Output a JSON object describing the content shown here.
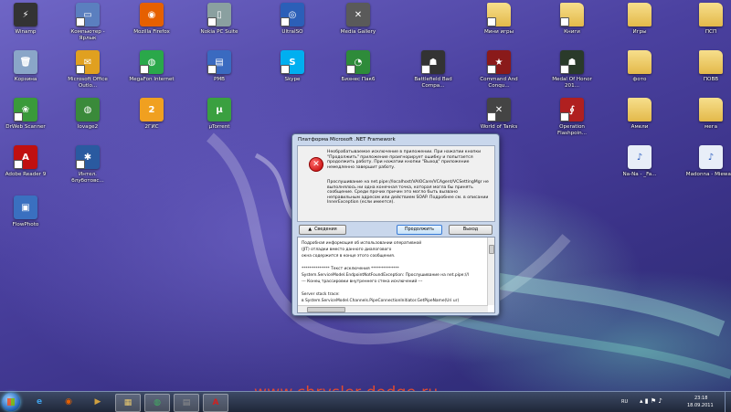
{
  "desktop": {
    "icons": [
      {
        "label": "Winamp",
        "color": "#333333",
        "glyph": "⚡",
        "link": false
      },
      {
        "label": "Компьютер - Ярлык",
        "color": "#5b7fbf",
        "glyph": "▭",
        "link": true
      },
      {
        "label": "Mozilla Firefox",
        "color": "#e66000",
        "glyph": "◉",
        "link": false
      },
      {
        "label": "Nokia PC Suite",
        "color": "#8aa0a0",
        "glyph": "▯",
        "link": true
      },
      {
        "label": "UltraISO",
        "color": "#2b5fb8",
        "glyph": "◎",
        "link": true
      },
      {
        "label": "Media Gallery",
        "color": "#5a5a5a",
        "glyph": "✕",
        "link": false
      },
      {
        "label": "Мини игры",
        "folder": true,
        "link": true
      },
      {
        "label": "Книги",
        "folder": true,
        "link": true
      },
      {
        "label": "Игры",
        "folder": true,
        "link": false
      },
      {
        "label": "ПСП",
        "folder": true,
        "link": false
      },
      {
        "label": "Корзина",
        "color": "#8aa6c8",
        "glyph": "🗑",
        "link": false
      },
      {
        "label": "Microsoft Office Outlo...",
        "color": "#e0a020",
        "glyph": "✉",
        "link": true
      },
      {
        "label": "MegaFon Internet",
        "color": "#2aa84a",
        "glyph": "◍",
        "link": true
      },
      {
        "label": "PMB",
        "color": "#3a6ac0",
        "glyph": "▤",
        "link": true
      },
      {
        "label": "Skype",
        "color": "#00aff0",
        "glyph": "S",
        "link": true
      },
      {
        "label": "Бизнес Пак6",
        "color": "#2e8b3a",
        "glyph": "◔",
        "link": true
      },
      {
        "label": "Battlefield Bad Compa...",
        "color": "#333333",
        "glyph": "☗",
        "link": true
      },
      {
        "label": "Command And Conqu...",
        "color": "#8a1a1a",
        "glyph": "★",
        "link": true
      },
      {
        "label": "Medal Of Honor 201...",
        "color": "#2a3a2a",
        "glyph": "☗",
        "link": true
      },
      {
        "label": "фото",
        "folder": true,
        "link": false
      },
      {
        "label": "ПОВВ",
        "folder": true,
        "link": false
      },
      {
        "label": "DrWeb Scanner",
        "color": "#3a9a3a",
        "glyph": "❀",
        "link": true
      },
      {
        "label": "lovage2",
        "color": "#3a8a3a",
        "glyph": "◍",
        "link": false
      },
      {
        "label": "2ГИС",
        "color": "#f0a020",
        "glyph": "2",
        "link": false
      },
      {
        "label": "µTorrent",
        "color": "#3aa040",
        "glyph": "µ",
        "link": false
      },
      {
        "label": "World of Tanks",
        "color": "#444444",
        "glyph": "✕",
        "link": true
      },
      {
        "label": "Operation Flashpoin...",
        "color": "#b02020",
        "glyph": "∮",
        "link": true
      },
      {
        "label": "Амели",
        "folder": true,
        "link": false
      },
      {
        "label": "мега",
        "folder": true,
        "link": false
      },
      {
        "label": "Adobe Reader 9",
        "color": "#c01010",
        "glyph": "A",
        "link": true
      },
      {
        "label": "Интел. блуботовс...",
        "color": "#2a5aa0",
        "glyph": "✱",
        "link": true
      },
      {
        "label": "Na-Na - _Fa...",
        "color": "#e8eef8",
        "glyph": "♪",
        "link": false
      },
      {
        "label": "Madonna - Miewa...",
        "color": "#e8eef8",
        "glyph": "♪",
        "link": false
      },
      {
        "label": "FlowPhoto",
        "color": "#3a70c0",
        "glyph": "▣",
        "link": false
      }
    ]
  },
  "dialog": {
    "title": "Платформа Microsoft .NET Framework",
    "message_1": "Необрабатываемое исключение в приложении. При нажатии кнопки \"Продолжить\" приложение проигнорирует ошибку и попытается продолжить работу. При нажатии кнопки \"Выход\" приложение немедленно завершит работу.",
    "message_2": "Прослушивание на net.pipe://localhost/VAIOCare/VCAgent/VCSettingMgr не выполнялось ни одна конечная точка, которая могла бы принять сообщение. Среди прочих причин это могло быть вызвано неправильным адресом или действием SOAP. Подробнее см. в описании InnerException (если имеется).",
    "details_button": "Сведения",
    "continue_button": "Продолжить",
    "exit_button": "Выход",
    "details_lines": [
      "Подробная информация об использовании оперативной",
      "(JIT) отладки вместо данного диалогового",
      "окна содержится в конце этого сообщения.",
      "",
      "************** Текст исключения **************",
      "System.ServiceModel.EndpointNotFoundException: Прослушивание на net.pipe://l",
      "   --- Конец трассировки внутреннего стека исключений ---",
      "",
      "Server stack trace:",
      "   в System.ServiceModel.Channels.PipeConnectionInitiator.GetPipeName(Uri ur)"
    ]
  },
  "taskbar": {
    "language": "RU",
    "time": "23:18",
    "date": "18.09.2011",
    "watermark": "www.chrysler-dodge.ru",
    "pinned": [
      {
        "name": "ie",
        "glyph": "e",
        "color": "#3fa0e8"
      },
      {
        "name": "firefox",
        "glyph": "◉",
        "color": "#e66000"
      },
      {
        "name": "player",
        "glyph": "▶",
        "color": "#d0a040"
      },
      {
        "name": "explorer",
        "glyph": "▦",
        "color": "#e8c870"
      },
      {
        "name": "mail",
        "glyph": "◍",
        "color": "#40b060"
      },
      {
        "name": "console",
        "glyph": "▤",
        "color": "#909090"
      },
      {
        "name": "acrobat",
        "glyph": "A",
        "color": "#d02020"
      }
    ]
  }
}
